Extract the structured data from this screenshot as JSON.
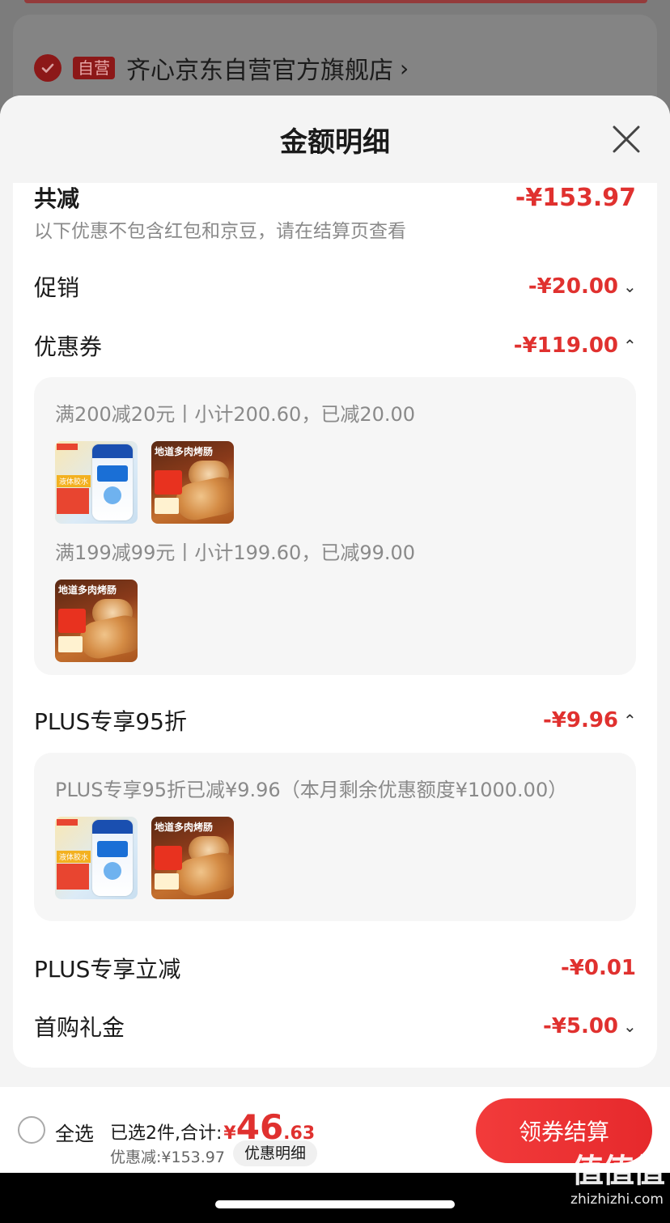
{
  "background": {
    "shop_tag": "自营",
    "shop_name": "齐心京东自营官方旗舰店",
    "shop_chevron": "›"
  },
  "sheet": {
    "title": "金额明细",
    "close_glyph": "✕"
  },
  "summary": {
    "label": "共减",
    "amount": "-¥153.97",
    "note": "以下优惠不包含红包和京豆，请在结算页查看"
  },
  "rows": {
    "promo": {
      "label": "促销",
      "amount": "-¥20.00",
      "caret": "⌄"
    },
    "coupon": {
      "label": "优惠券",
      "amount": "-¥119.00",
      "caret": "⌃"
    },
    "plus95": {
      "label": "PLUS专享95折",
      "amount": "-¥9.96",
      "caret": "⌃"
    },
    "plus_instant": {
      "label": "PLUS专享立减",
      "amount": "-¥0.01"
    },
    "first_gift": {
      "label": "首购礼金",
      "amount": "-¥5.00",
      "caret": "⌄"
    }
  },
  "coupon_detail": {
    "line1": "满200减20元丨小计200.60，已减20.00",
    "line2": "满199减99元丨小计199.60，已减99.00"
  },
  "plus_detail": {
    "line1": "PLUS专享95折已减¥9.96（本月剩余优惠额度¥1000.00）"
  },
  "products": {
    "gel": {
      "icon": "glue-bottle-product-image",
      "tag": "液体胶水"
    },
    "sausage": {
      "icon": "sausage-product-image",
      "headline": "地道多肉烤肠"
    }
  },
  "bottom_bar": {
    "select_all": "全选",
    "selected_text": "已选2件,合计:",
    "currency": "¥",
    "total_int": "46",
    "total_dec": ".63",
    "saved_text": "优惠减:¥153.97",
    "detail_button": "优惠明细",
    "checkout_button": "领券结算"
  },
  "watermark": {
    "big": "值值值",
    "small": "zhizhizhi.com"
  },
  "colors": {
    "accent_red": "#e0312f",
    "checkout_red": "#f23b3b"
  }
}
